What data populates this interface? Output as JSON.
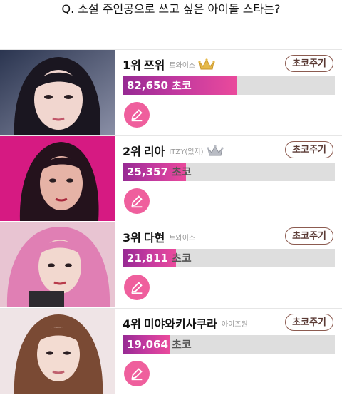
{
  "question": "Q. 소설 주인공으로 쓰고 싶은 아이돌 스타는?",
  "gift_label": "초코주기",
  "unit": "초코",
  "colors": {
    "accent": "#e8438d",
    "bar_start": "#962a93",
    "bar_end": "#ea4a9c",
    "track": "#dedede",
    "button_border": "#8c5b50"
  },
  "rankings": [
    {
      "rank": "1위",
      "name": "쯔위",
      "group": "트와이스",
      "votes": "82,650",
      "share": 0.54,
      "crown": "gold-crown-icon"
    },
    {
      "rank": "2위",
      "name": "리아",
      "group": "ITZY(있지)",
      "votes": "25,357",
      "share": 0.3,
      "crown": "silver-crown-icon"
    },
    {
      "rank": "3위",
      "name": "다현",
      "group": "트와이스",
      "votes": "21,811",
      "share": 0.25
    },
    {
      "rank": "4위",
      "name": "미야와키사쿠라",
      "group": "아이즈원",
      "votes": "19,064",
      "share": 0.22
    }
  ]
}
